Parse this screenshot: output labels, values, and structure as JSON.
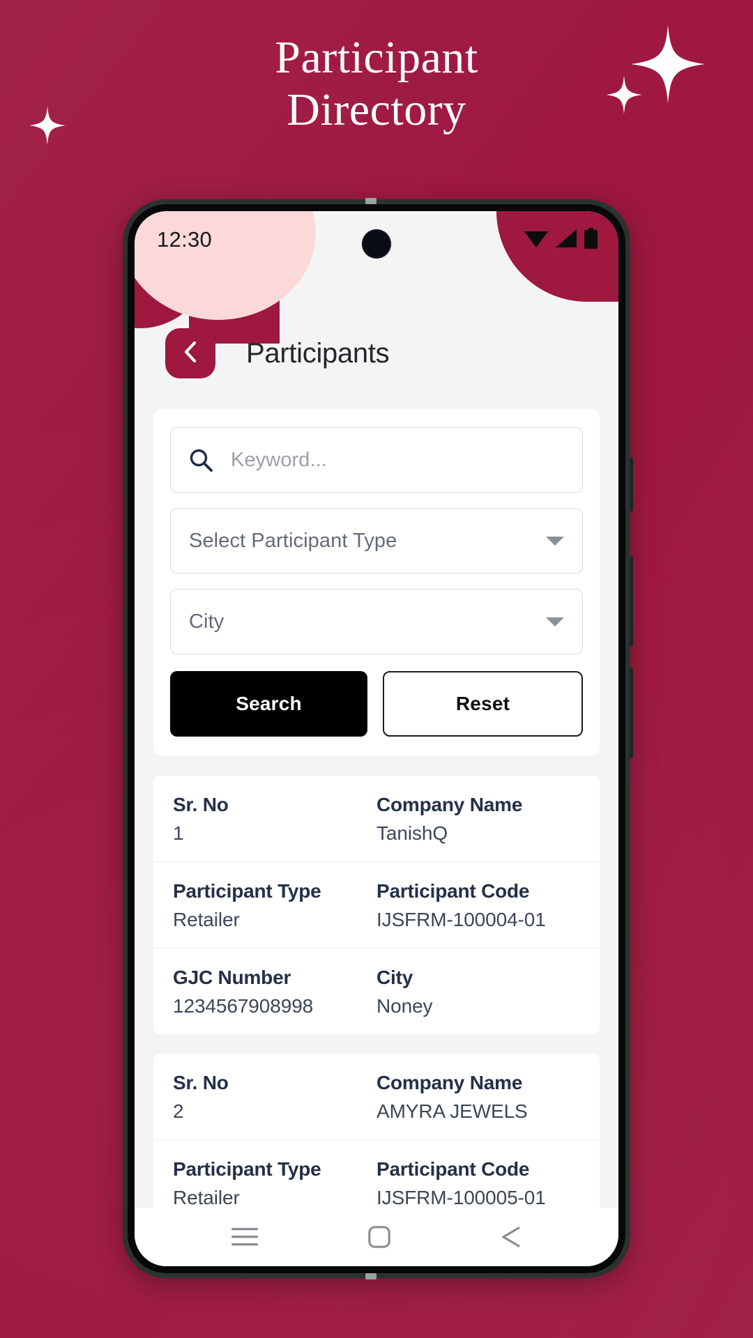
{
  "poster": {
    "title_line1": "Participant",
    "title_line2": "Directory",
    "background_color": "#9e1840",
    "accent_color": "#9e1840"
  },
  "phone": {
    "statusbar": {
      "time": "12:30",
      "icons": [
        "wifi-icon",
        "cellular-signal-icon",
        "battery-icon"
      ]
    },
    "appbar": {
      "back_icon": "chevron-left-icon",
      "title": "Participants"
    },
    "filters": {
      "keyword": {
        "icon": "search-icon",
        "value": "",
        "placeholder": "Keyword..."
      },
      "participant_type": {
        "value": "Select Participant Type",
        "caret_icon": "caret-down-icon"
      },
      "city": {
        "value": "City",
        "caret_icon": "caret-down-icon"
      },
      "search_label": "Search",
      "reset_label": "Reset"
    },
    "labels": {
      "sr_no": "Sr. No",
      "company_name": "Company Name",
      "participant_type": "Participant Type",
      "participant_code": "Participant Code",
      "gjc_number": "GJC Number",
      "city": "City"
    },
    "results": [
      {
        "sr_no": "1",
        "company_name": "TanishQ",
        "participant_type": "Retailer",
        "participant_code": "IJSFRM-100004-01",
        "gjc_number": "1234567908998",
        "city": "Noney"
      },
      {
        "sr_no": "2",
        "company_name": "AMYRA JEWELS",
        "participant_type": "Retailer",
        "participant_code": "IJSFRM-100005-01",
        "gjc_number": "",
        "city": ""
      }
    ],
    "navbar": {
      "items": [
        "recents-menu-icon",
        "home-square-icon",
        "back-triangle-icon"
      ]
    }
  }
}
